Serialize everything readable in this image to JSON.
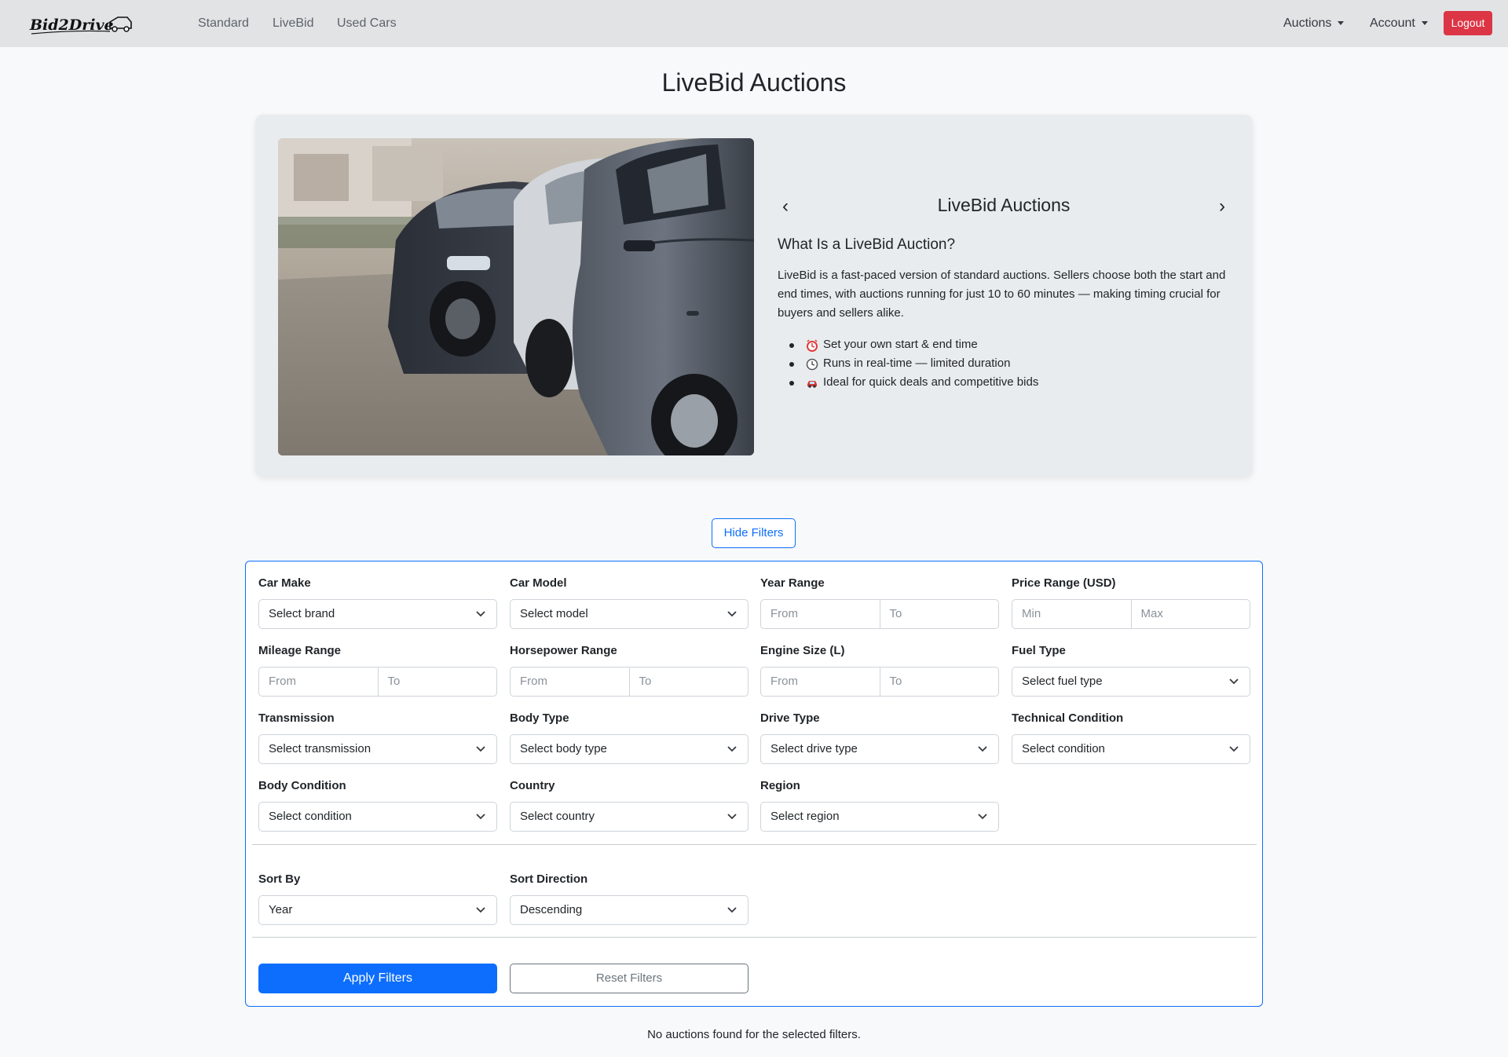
{
  "brand": {
    "logo_text": "Bid2Drive"
  },
  "nav": {
    "links": [
      "Standard",
      "LiveBid",
      "Used Cars"
    ],
    "auctions_label": "Auctions",
    "account_label": "Account",
    "logout_label": "Logout"
  },
  "page": {
    "title": "LiveBid Auctions"
  },
  "hero": {
    "carousel_title": "LiveBid Auctions",
    "heading": "What Is a LiveBid Auction?",
    "description": "LiveBid is a fast-paced version of standard auctions. Sellers choose both the start and end times, with auctions running for just 10 to 60 minutes — making timing crucial for buyers and sellers alike.",
    "bullets": [
      {
        "icon": "alarm-clock-icon",
        "text": "Set your own start & end time"
      },
      {
        "icon": "clock-icon",
        "text": "Runs in real-time — limited duration"
      },
      {
        "icon": "car-icon",
        "text": "Ideal for quick deals and competitive bids"
      }
    ]
  },
  "filters": {
    "toggle_label": "Hide Filters",
    "car_make": {
      "label": "Car Make",
      "value": "Select brand"
    },
    "car_model": {
      "label": "Car Model",
      "value": "Select model"
    },
    "year_range": {
      "label": "Year Range",
      "from": "From",
      "to": "To"
    },
    "price_range": {
      "label": "Price Range (USD)",
      "from": "Min",
      "to": "Max"
    },
    "mileage_range": {
      "label": "Mileage Range",
      "from": "From",
      "to": "To"
    },
    "horsepower_range": {
      "label": "Horsepower Range",
      "from": "From",
      "to": "To"
    },
    "engine_size": {
      "label": "Engine Size (L)",
      "from": "From",
      "to": "To"
    },
    "fuel_type": {
      "label": "Fuel Type",
      "value": "Select fuel type"
    },
    "transmission": {
      "label": "Transmission",
      "value": "Select transmission"
    },
    "body_type": {
      "label": "Body Type",
      "value": "Select body type"
    },
    "drive_type": {
      "label": "Drive Type",
      "value": "Select drive type"
    },
    "technical_condition": {
      "label": "Technical Condition",
      "value": "Select condition"
    },
    "body_condition": {
      "label": "Body Condition",
      "value": "Select condition"
    },
    "country": {
      "label": "Country",
      "value": "Select country"
    },
    "region": {
      "label": "Region",
      "value": "Select region"
    },
    "sort_by": {
      "label": "Sort By",
      "value": "Year"
    },
    "sort_direction": {
      "label": "Sort Direction",
      "value": "Descending"
    },
    "apply_label": "Apply Filters",
    "reset_label": "Reset Filters"
  },
  "results": {
    "empty_message": "No auctions found for the selected filters."
  },
  "colors": {
    "primary": "#0d6efd",
    "danger": "#dc3545",
    "navbar_bg": "#e2e3e5",
    "hero_bg": "#e9ecef"
  }
}
